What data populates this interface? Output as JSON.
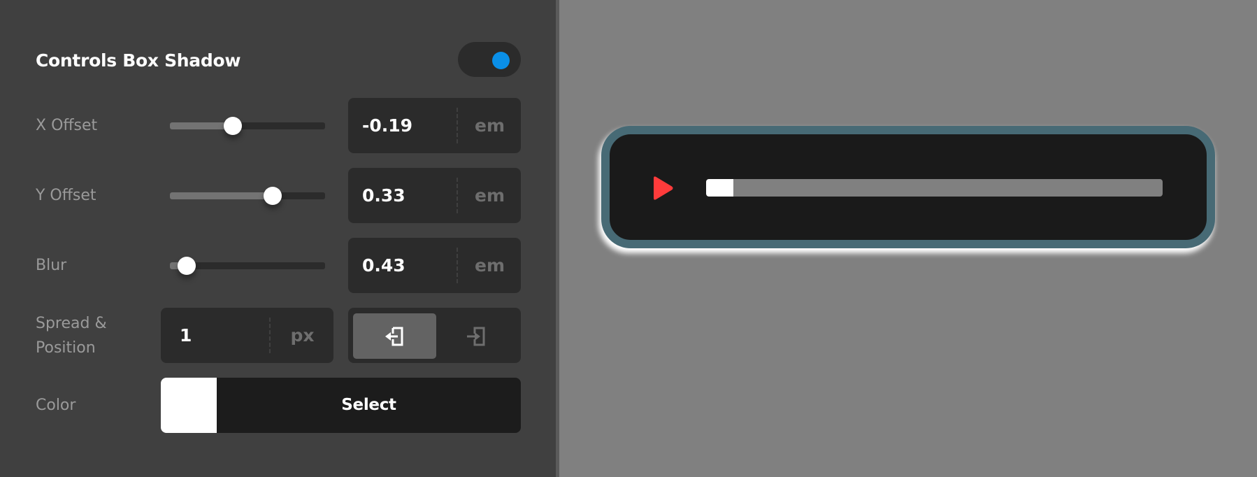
{
  "panel": {
    "title": "Controls Box Shadow",
    "enabled": true,
    "accent_color": "#0a8fe8",
    "rows": {
      "x_offset": {
        "label": "X Offset",
        "value": "-0.19",
        "unit": "em",
        "slider_fraction": 0.405
      },
      "y_offset": {
        "label": "Y Offset",
        "value": "0.33",
        "unit": "em",
        "slider_fraction": 0.66
      },
      "blur": {
        "label": "Blur",
        "value": "0.43",
        "unit": "em",
        "slider_fraction": 0.11
      },
      "spread": {
        "label_line1": "Spread &",
        "label_line2": "Position",
        "value": "1",
        "unit": "px"
      },
      "position": {
        "options": [
          {
            "id": "outset",
            "icon": "box-arrow-out-icon",
            "active": true
          },
          {
            "id": "inset",
            "icon": "box-arrow-in-icon",
            "active": false
          }
        ]
      },
      "color": {
        "label": "Color",
        "swatch": "#ffffff",
        "button_label": "Select"
      }
    }
  },
  "preview": {
    "border_color": "#476a75",
    "background_color": "#1a1a1a",
    "play_icon_color": "#ff3b3b",
    "progress_fraction": 0.06
  }
}
